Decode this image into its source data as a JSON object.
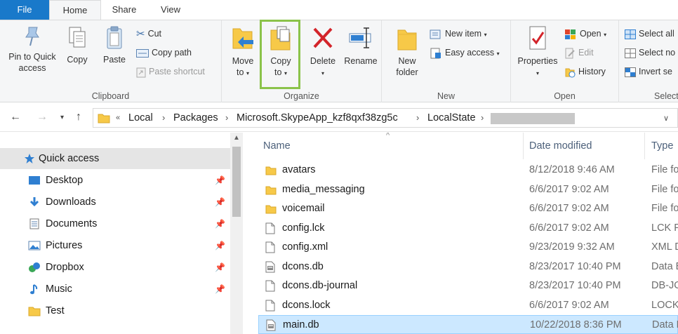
{
  "tabs": {
    "file": "File",
    "home": "Home",
    "share": "Share",
    "view": "View"
  },
  "ribbon": {
    "clipboard": {
      "label": "Clipboard",
      "pin": "Pin to Quick",
      "pin2": "access",
      "copy": "Copy",
      "paste": "Paste",
      "cut": "Cut",
      "copy_path": "Copy path",
      "paste_shortcut": "Paste shortcut"
    },
    "organize": {
      "label": "Organize",
      "move_to": "Move",
      "move_to2": "to",
      "copy_to": "Copy",
      "copy_to2": "to",
      "delete": "Delete",
      "rename": "Rename"
    },
    "new": {
      "label": "New",
      "new_folder": "New",
      "new_folder2": "folder",
      "new_item": "New item",
      "easy_access": "Easy access"
    },
    "open": {
      "label": "Open",
      "properties": "Properties",
      "open": "Open",
      "edit": "Edit",
      "history": "History"
    },
    "select": {
      "label": "Select",
      "select_all": "Select all",
      "select_none": "Select no",
      "invert": "Invert se"
    }
  },
  "address": {
    "overflow": "«",
    "crumbs": [
      "Local",
      "Packages",
      "Microsoft.SkypeApp_kzf8qxf38zg5c",
      "LocalState"
    ]
  },
  "nav": {
    "items": [
      {
        "label": "Quick access",
        "icon": "star-icon"
      },
      {
        "label": "Desktop",
        "icon": "desktop-icon"
      },
      {
        "label": "Downloads",
        "icon": "download-icon"
      },
      {
        "label": "Documents",
        "icon": "documents-icon"
      },
      {
        "label": "Pictures",
        "icon": "pictures-icon"
      },
      {
        "label": "Dropbox",
        "icon": "dropbox-icon"
      },
      {
        "label": "Music",
        "icon": "music-icon"
      },
      {
        "label": "Test",
        "icon": "folder-icon"
      }
    ]
  },
  "columns": {
    "name": "Name",
    "date": "Date modified",
    "type": "Type"
  },
  "files": [
    {
      "name": "avatars",
      "date": "8/12/2018 9:46 AM",
      "type": "File fo",
      "kind": "folder"
    },
    {
      "name": "media_messaging",
      "date": "6/6/2017 9:02 AM",
      "type": "File fo",
      "kind": "folder"
    },
    {
      "name": "voicemail",
      "date": "6/6/2017 9:02 AM",
      "type": "File fo",
      "kind": "folder"
    },
    {
      "name": "config.lck",
      "date": "6/6/2017 9:02 AM",
      "type": "LCK Fi",
      "kind": "file"
    },
    {
      "name": "config.xml",
      "date": "9/23/2019 9:32 AM",
      "type": "XML D",
      "kind": "file"
    },
    {
      "name": "dcons.db",
      "date": "8/23/2017 10:40 PM",
      "type": "Data B",
      "kind": "db"
    },
    {
      "name": "dcons.db-journal",
      "date": "8/23/2017 10:40 PM",
      "type": "DB-JO",
      "kind": "file"
    },
    {
      "name": "dcons.lock",
      "date": "6/6/2017 9:02 AM",
      "type": "LOCK",
      "kind": "file"
    },
    {
      "name": "main.db",
      "date": "10/22/2018 8:36 PM",
      "type": "Data B",
      "kind": "db"
    }
  ]
}
